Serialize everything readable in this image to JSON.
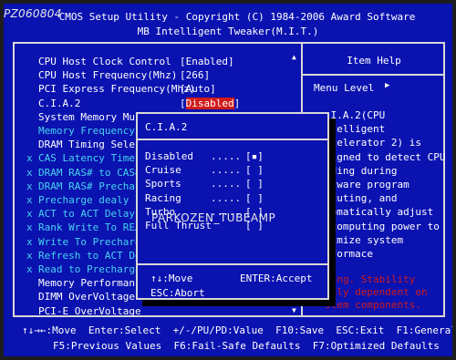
{
  "watermark": "PZ060804",
  "header": {
    "line1": "CMOS Setup Utility - Copyright (C) 1984-2006 Award Software",
    "line2": "MB Intelligent Tweaker(M.I.T.)"
  },
  "settings": [
    {
      "label": "CPU Host Clock Control",
      "value": "[Enabled]",
      "style": "white",
      "x": false
    },
    {
      "label": "CPU Host Frequency(Mhz)",
      "value": "[266]",
      "style": "white",
      "x": false
    },
    {
      "label": "PCI Express Frequency(Mhz)",
      "value": "[Auto]",
      "style": "white",
      "x": false
    },
    {
      "label": "C.I.A.2",
      "value": "[Disabled]",
      "style": "white",
      "x": false,
      "selected": true
    },
    {
      "label": "System Memory Mul",
      "value": "",
      "style": "white",
      "x": false
    },
    {
      "label": "Memory Frequency(",
      "value": "",
      "style": "cyan",
      "x": false
    },
    {
      "label": "DRAM Timing Selec",
      "value": "",
      "style": "white",
      "x": false
    },
    {
      "label": "CAS Latency Time",
      "value": "",
      "style": "cyan",
      "x": true
    },
    {
      "label": "DRAM RAS# to CAS#",
      "value": "",
      "style": "cyan",
      "x": true
    },
    {
      "label": "DRAM RAS# Prechar",
      "value": "",
      "style": "cyan",
      "x": true
    },
    {
      "label": "Precharge dealy (",
      "value": "",
      "style": "cyan",
      "x": true
    },
    {
      "label": "ACT to ACT Delay",
      "value": "",
      "style": "cyan",
      "x": true
    },
    {
      "label": "Rank Write To REA",
      "value": "",
      "style": "cyan",
      "x": true
    },
    {
      "label": "Write To Precharg",
      "value": "",
      "style": "cyan",
      "x": true
    },
    {
      "label": "Refresh to ACT De",
      "value": "",
      "style": "cyan",
      "x": true
    },
    {
      "label": "Read to Precharge",
      "value": "",
      "style": "cyan",
      "x": true
    },
    {
      "label": "Memory Performanc",
      "value": "",
      "style": "white",
      "x": false
    },
    {
      "label": "DIMM OverVoltage",
      "value": "",
      "style": "white",
      "x": false
    },
    {
      "label": "PCI-E OverVoltage",
      "value": "",
      "style": "white",
      "x": false
    }
  ],
  "item_help": {
    "title": "Item Help",
    "menu_level": "Menu Level",
    "lines": [
      ".I.A.2(CPU",
      "ntelligent",
      "ccelerator 2) is",
      "signed to detect CPU",
      "ading during",
      "ftware program",
      "ecuting, and",
      "tomatically adjust",
      " computing power to",
      "ximize system",
      "rformace"
    ],
    "red_lines": [
      "ting. Stability",
      "ghly dependent on",
      "stem components."
    ]
  },
  "popup": {
    "title": "C.I.A.2",
    "options": [
      {
        "name": "Disabled",
        "dots": ".....",
        "box": "[▪]"
      },
      {
        "name": "Cruise",
        "dots": ".....",
        "box": "[ ]"
      },
      {
        "name": "Sports",
        "dots": ".....",
        "box": "[ ]"
      },
      {
        "name": "Racing",
        "dots": ".....",
        "box": "[ ]"
      },
      {
        "name": "Turbo",
        "dots": ".....",
        "box": "[ ]"
      },
      {
        "name": "Full Thrust",
        "dots": ".....",
        "box": "[ ]"
      }
    ],
    "key_move": "↑↓:Move",
    "key_accept": "ENTER:Accept",
    "key_abort": "ESC:Abort"
  },
  "overlay_text": "PARKOZEN_TUBEAMP",
  "footer": {
    "line1": "↑↓→←:Move  Enter:Select  +/-/PU/PD:Value  F10:Save  ESC:Exit  F1:General Help",
    "line2": "F5:Previous Values  F6:Fail-Safe Defaults  F7:Optimized Defaults"
  },
  "colors": {
    "background": "#0a12b0",
    "highlight": "#d11b1b",
    "disabled_text": "#46d3ee",
    "text": "#ffffff"
  }
}
